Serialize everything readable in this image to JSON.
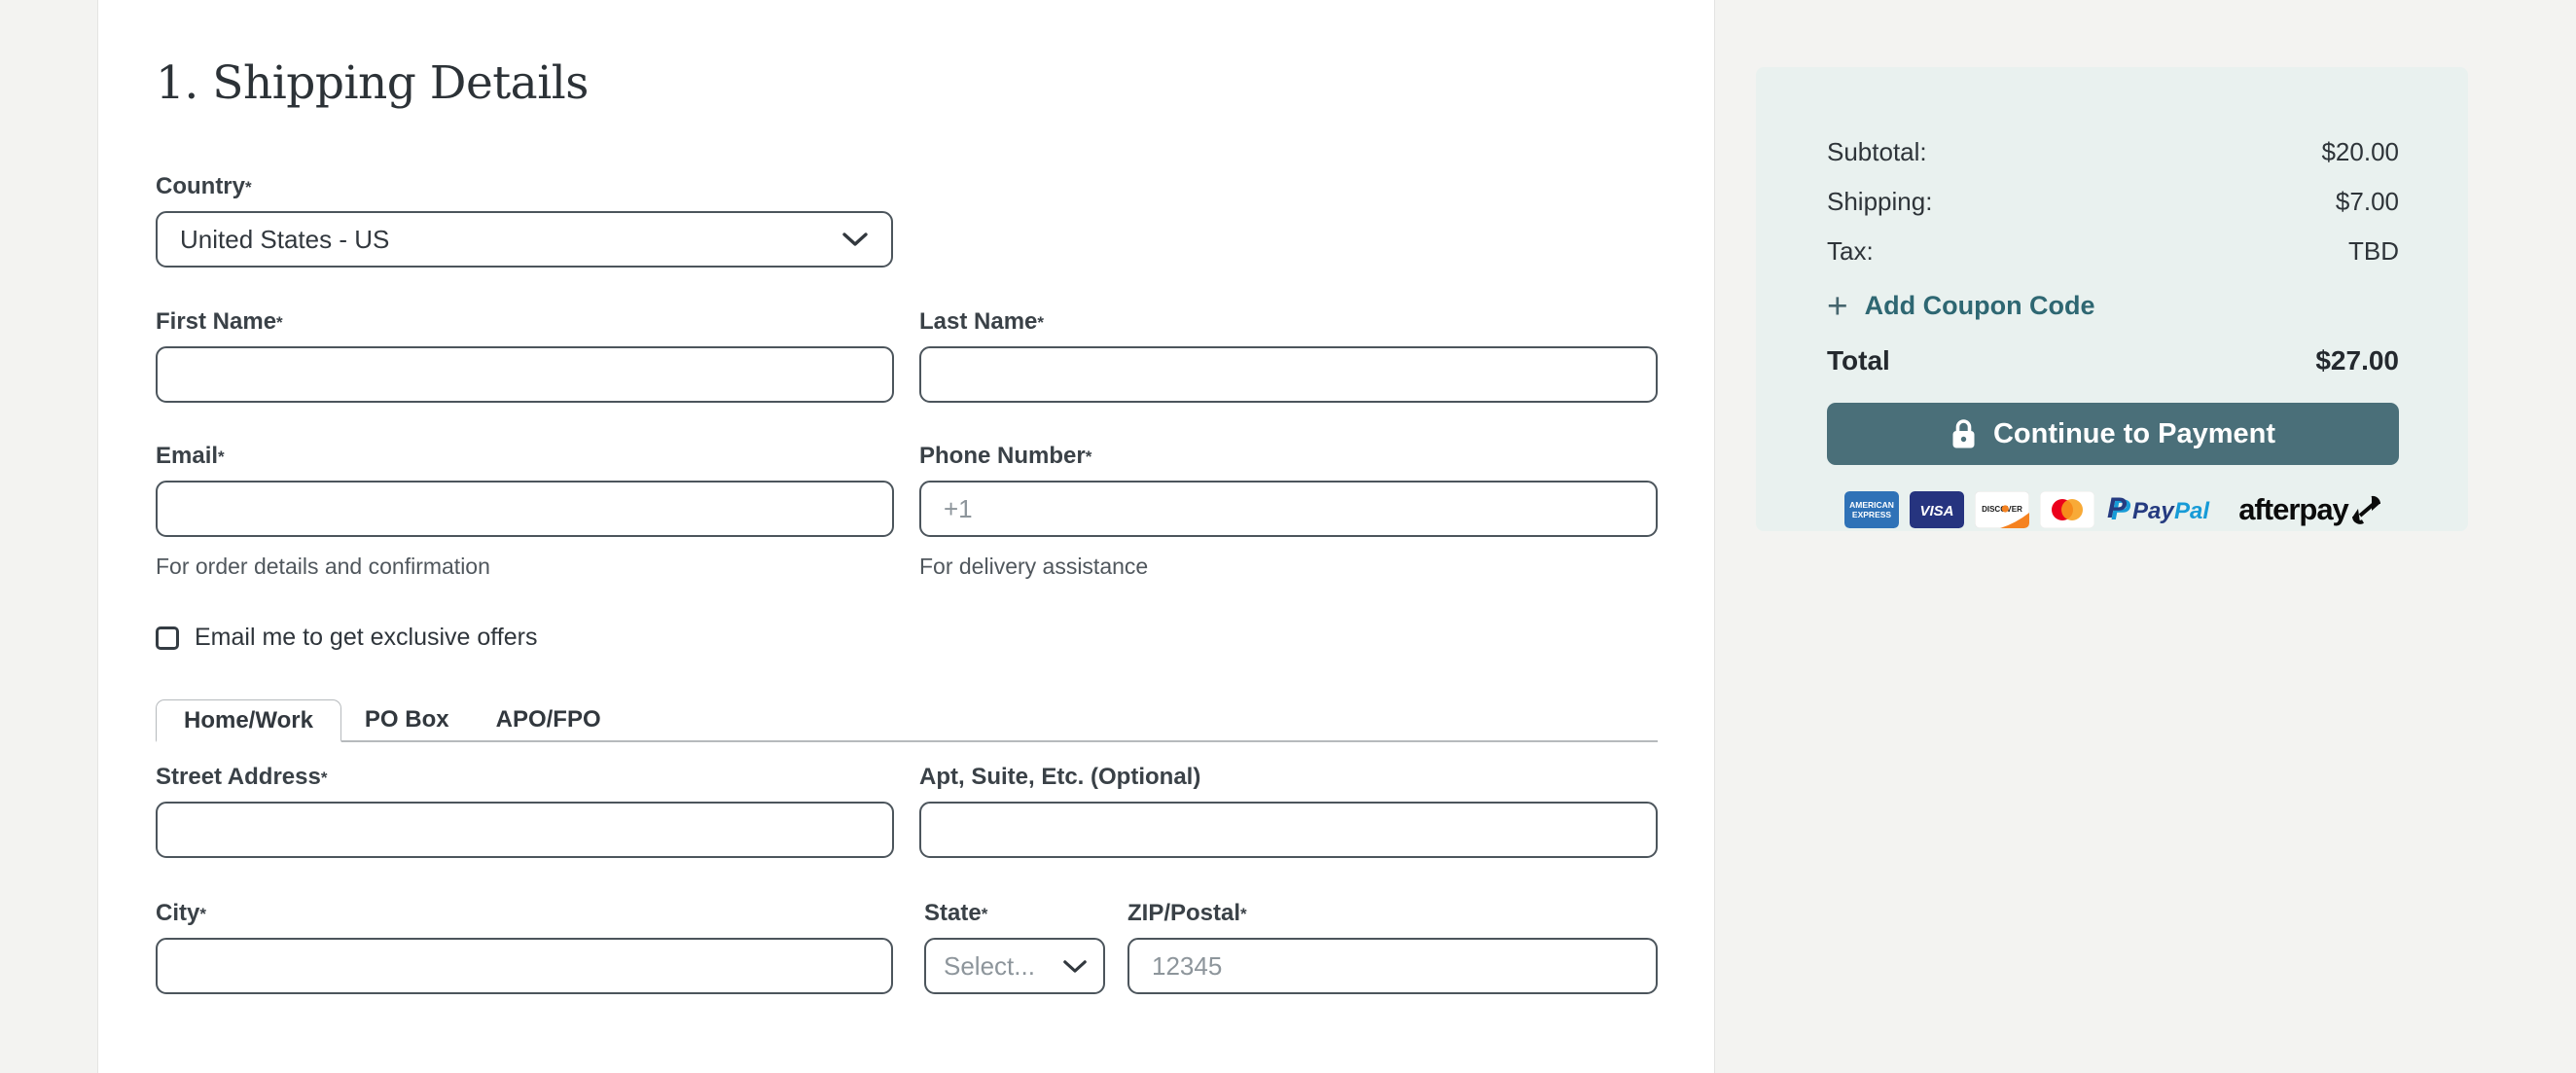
{
  "page": {
    "title_heading": "1. Shipping Details"
  },
  "form": {
    "required_marker": "*",
    "country": {
      "label": "Country",
      "value": "United States - US"
    },
    "first_name": {
      "label": "First Name",
      "value": ""
    },
    "last_name": {
      "label": "Last Name",
      "value": ""
    },
    "email": {
      "label": "Email",
      "value": "",
      "helper": "For order details and confirmation"
    },
    "phone": {
      "label": "Phone Number",
      "value": "",
      "placeholder": "+1",
      "helper": "For delivery assistance"
    },
    "email_optin": {
      "label": "Email me to get exclusive offers",
      "checked": false
    },
    "tabs": [
      {
        "label": "Home/Work",
        "active": true
      },
      {
        "label": "PO Box",
        "active": false
      },
      {
        "label": "APO/FPO",
        "active": false
      }
    ],
    "street": {
      "label": "Street Address",
      "value": ""
    },
    "apt": {
      "label": "Apt, Suite, Etc. (Optional)",
      "value": ""
    },
    "city": {
      "label": "City",
      "value": ""
    },
    "state": {
      "label": "State",
      "placeholder_option": "Select..."
    },
    "zip": {
      "label": "ZIP/Postal",
      "value": "",
      "placeholder": "12345"
    }
  },
  "summary": {
    "rows": [
      {
        "label": "Subtotal:",
        "value": "$20.00"
      },
      {
        "label": "Shipping:",
        "value": "$7.00"
      },
      {
        "label": "Tax:",
        "value": "TBD"
      }
    ],
    "coupon": {
      "plus": "+",
      "label": "Add Coupon Code"
    },
    "total_label": "Total",
    "total_value": "$27.00",
    "continue_label": "Continue to Payment",
    "payment": {
      "amex_line1": "AMERICAN",
      "amex_line2": "EXPRESS",
      "visa": "VISA",
      "discover": "DISCOVER",
      "paypal_icon": "P",
      "paypal_word1": "Pay",
      "paypal_word2": "Pal",
      "afterpay": "afterpay",
      "methods": [
        "American Express",
        "Visa",
        "Discover",
        "Mastercard",
        "PayPal",
        "Afterpay"
      ]
    }
  },
  "colors": {
    "accent_teal_button": "#4a6f79",
    "coupon_link_teal": "#2e6772",
    "panel_background": "#e9f1ef",
    "page_background": "#f3f3f1",
    "input_border": "#4c555c",
    "tab_divider": "#b6babd",
    "placeholder_gray": "#8d959b"
  }
}
